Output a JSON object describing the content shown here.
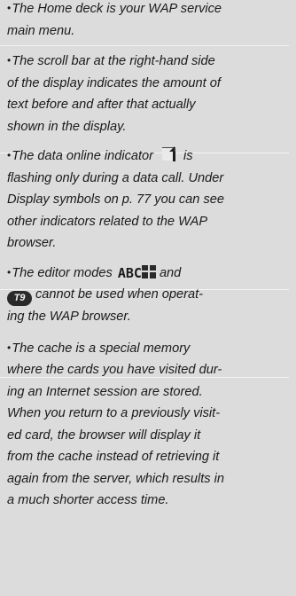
{
  "notes": [
    {
      "bullet": "•",
      "lines": [
        "The Home deck is your WAP service",
        "main menu."
      ]
    },
    {
      "bullet": "•",
      "lines": [
        "The scroll bar at the right-hand side",
        "of the display indicates the amount of",
        "text before and after that actually",
        "shown in the display."
      ]
    },
    {
      "bullet": "•",
      "line1_before_icon": "The data online indicator",
      "line1_after_icon": "is",
      "icon": "data-online-indicator-icon",
      "lines": [
        "flashing only during a data call. Under",
        "Display symbols on p. 77 you can see",
        "other indicators related to the WAP",
        "browser."
      ]
    },
    {
      "bullet": "•",
      "line1_before_icon": "The editor modes",
      "line1_after_icon": "and",
      "abc_label": "ABC",
      "t9_label": "T9",
      "line2_after_icon": "cannot be  used when operat-",
      "lines": [
        "ing the WAP browser."
      ]
    },
    {
      "bullet": "•",
      "lines": [
        "The cache is a special memory",
        "where the cards you have visited dur-",
        "ing an Internet session are stored.",
        "When you return to a previously visit-",
        "ed card, the browser will display it",
        "from the cache instead of retrieving it",
        "again from the server, which results in",
        "a much shorter access time."
      ]
    }
  ],
  "colors": {
    "background": "#dcdcdc",
    "text": "#1a1a1a",
    "separator": "#f4f4f4"
  }
}
